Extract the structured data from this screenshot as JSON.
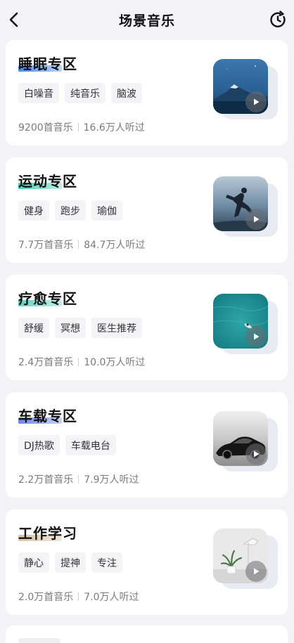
{
  "header": {
    "title": "场景音乐",
    "back_icon": "chevron-left-icon",
    "history_icon": "history-icon"
  },
  "cards": [
    {
      "title": "睡眠专区",
      "underline_color": "#4a8fe7",
      "tags": [
        "白噪音",
        "纯音乐",
        "脑波"
      ],
      "songs": "9200首音乐",
      "listeners": "16.6万人听过",
      "thumbnail": "mountain-night-image"
    },
    {
      "title": "运动专区",
      "underline_color": "#3fd0b8",
      "tags": [
        "健身",
        "跑步",
        "瑜伽"
      ],
      "songs": "7.7万首音乐",
      "listeners": "84.7万人听过",
      "thumbnail": "runner-image"
    },
    {
      "title": "疗愈专区",
      "underline_color": "#5fd0c0",
      "tags": [
        "舒缓",
        "冥想",
        "医生推荐"
      ],
      "songs": "2.4万首音乐",
      "listeners": "10.0万人听过",
      "thumbnail": "ocean-surfer-image"
    },
    {
      "title": "车载专区",
      "underline_color": "#6f86e8",
      "tags": [
        "DJ热歌",
        "车载电台"
      ],
      "songs": "2.2万首音乐",
      "listeners": "7.9万人听过",
      "thumbnail": "car-image"
    },
    {
      "title": "工作学习",
      "underline_color": "#d9c2a8",
      "tags": [
        "静心",
        "提神",
        "专注"
      ],
      "songs": "2.0万首音乐",
      "listeners": "7.0万人听过",
      "thumbnail": "desk-plant-lamp-image"
    }
  ]
}
